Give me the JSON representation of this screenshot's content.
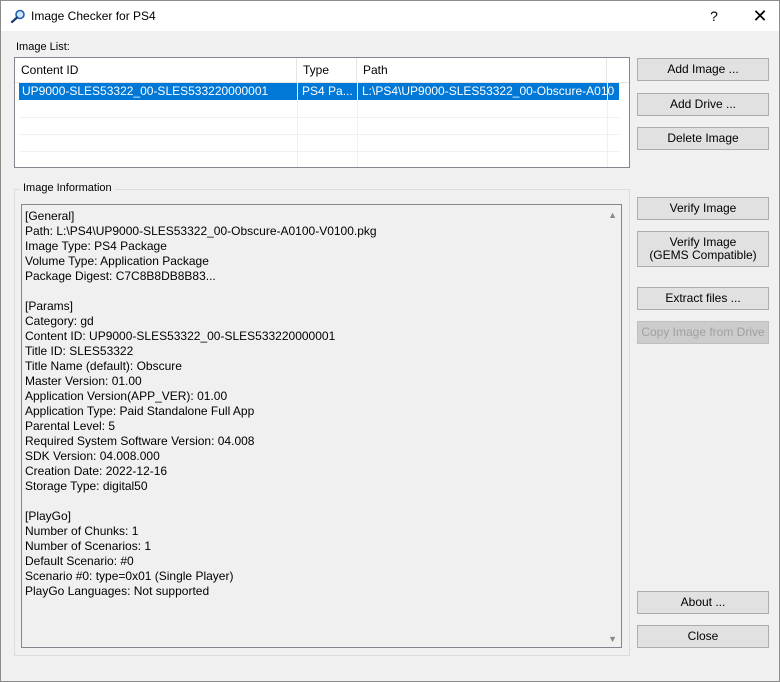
{
  "window": {
    "title": "Image Checker for PS4",
    "help": "?",
    "close": "✕"
  },
  "image_list": {
    "label": "Image List:",
    "columns": [
      "Content ID",
      "Type",
      "Path"
    ],
    "rows": [
      {
        "content_id": "UP9000-SLES53322_00-SLES533220000001",
        "type": "PS4 Pa...",
        "path": "L:\\PS4\\UP9000-SLES53322_00-Obscure-A010..."
      }
    ]
  },
  "buttons": {
    "add_image": "Add Image ...",
    "add_drive": "Add Drive ...",
    "delete_image": "Delete Image",
    "verify_image": "Verify Image",
    "verify_gems_line1": "Verify Image",
    "verify_gems_line2": "(GEMS Compatible)",
    "extract_files": "Extract files ...",
    "copy_from_drive": "Copy Image from Drive",
    "about": "About ...",
    "close": "Close"
  },
  "image_information": {
    "label": "Image Information",
    "lines": [
      "[General]",
      "Path: L:\\PS4\\UP9000-SLES53322_00-Obscure-A0100-V0100.pkg",
      "Image Type: PS4 Package",
      "Volume Type: Application Package",
      "Package Digest: C7C8B8DB8B83...",
      "",
      "[Params]",
      "Category: gd",
      "Content ID: UP9000-SLES53322_00-SLES533220000001",
      "Title ID: SLES53322",
      "Title Name (default): Obscure",
      "Master Version: 01.00",
      "Application Version(APP_VER): 01.00",
      "Application Type: Paid Standalone Full App",
      "Parental Level: 5",
      "Required System Software Version: 04.008",
      "SDK Version: 04.008.000",
      "Creation Date: 2022-12-16",
      "Storage Type: digital50",
      "",
      "[PlayGo]",
      "Number of Chunks: 1",
      "Number of Scenarios: 1",
      "Default Scenario: #0",
      "Scenario #0: type=0x01 (Single Player)",
      "PlayGo Languages: Not supported"
    ]
  },
  "colors": {
    "selection": "#0078d7",
    "button_face": "#e1e1e1",
    "window_bg": "#f0f0f0"
  }
}
